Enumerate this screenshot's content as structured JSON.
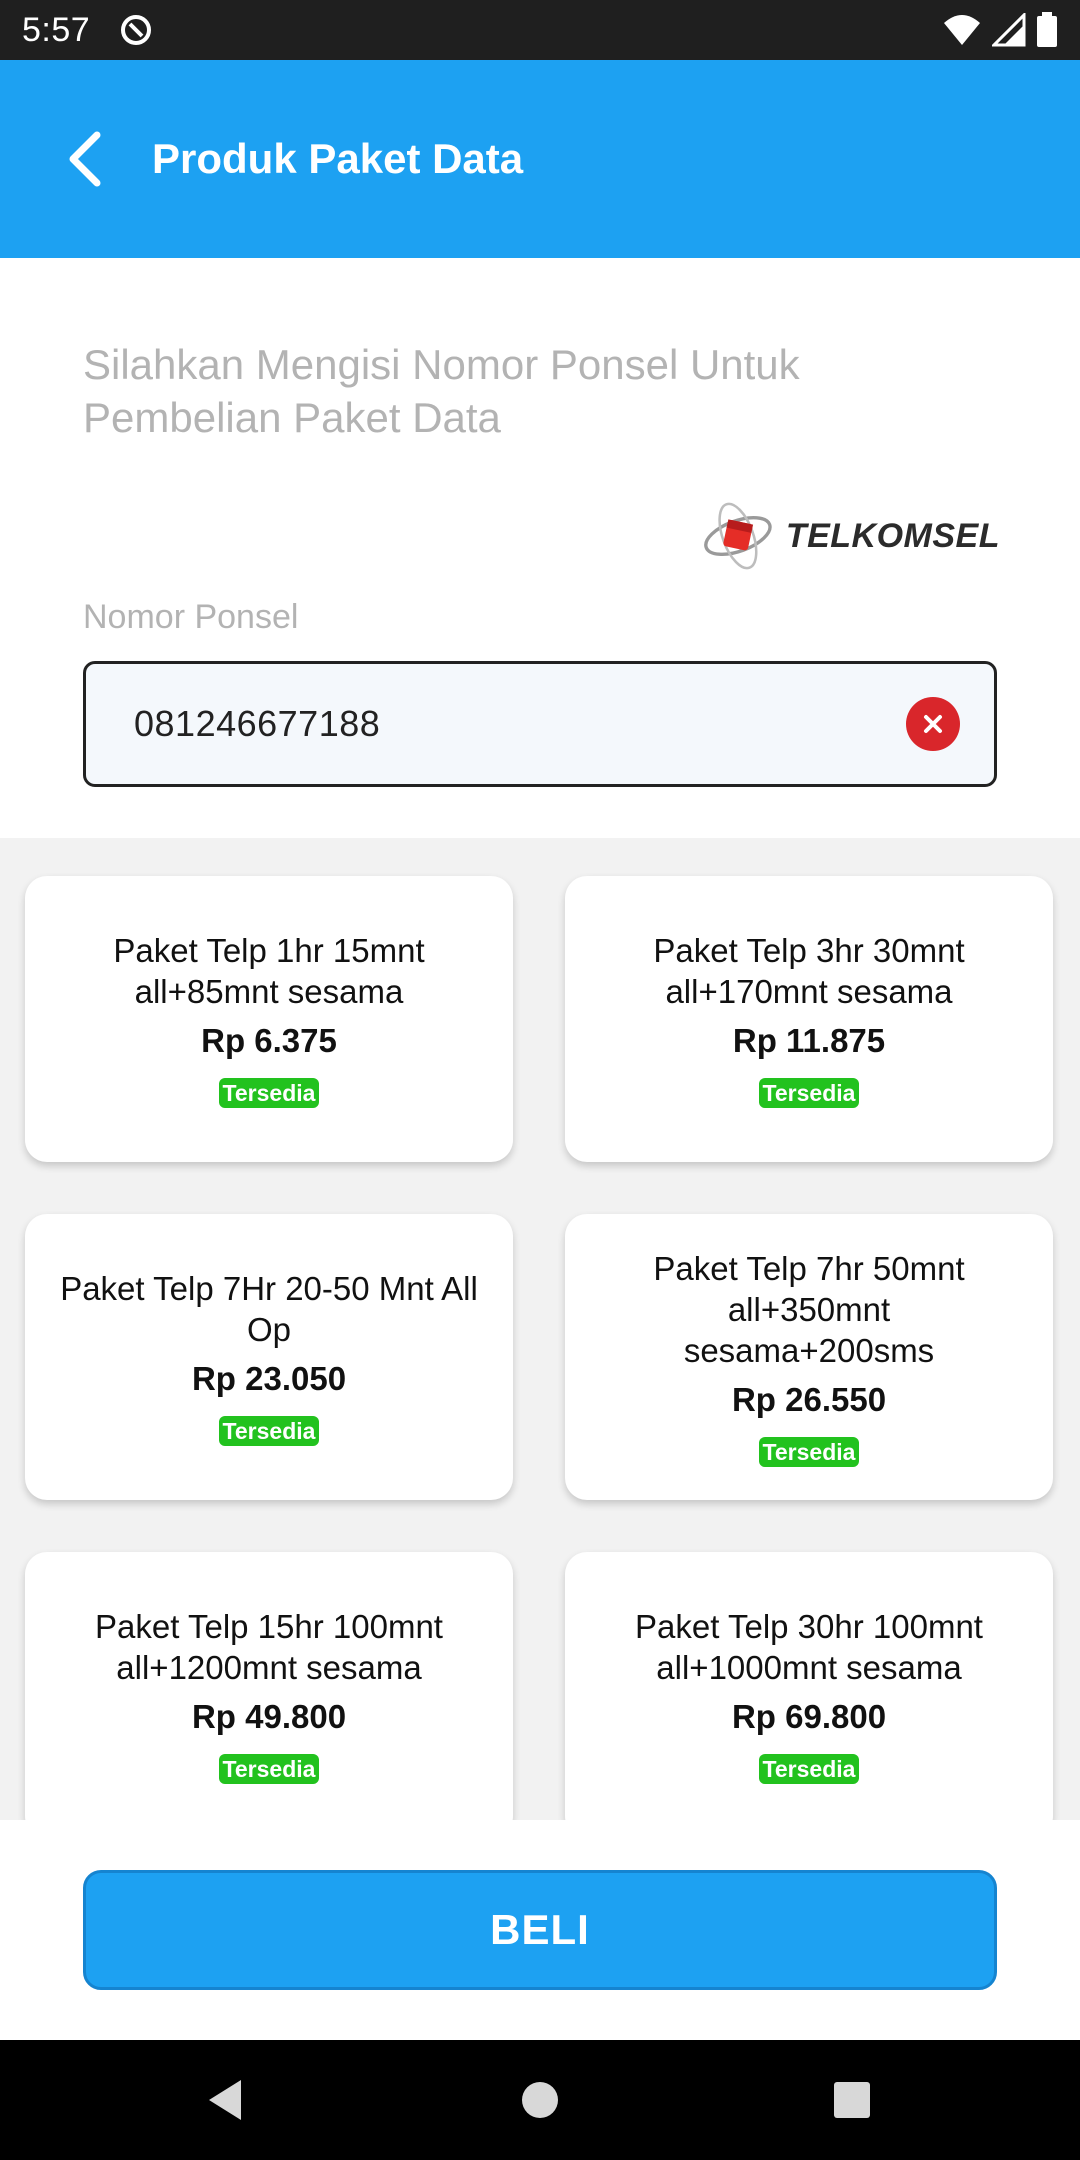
{
  "status_bar": {
    "time": "5:57"
  },
  "app_bar": {
    "title": "Produk Paket Data"
  },
  "form": {
    "instruction": "Silahkan Mengisi Nomor Ponsel Untuk Pembelian Paket Data",
    "operator": "TELKOMSEL",
    "phone_label": "Nomor Ponsel",
    "phone_value": "081246677188"
  },
  "packages": [
    {
      "name": "Paket Telp 1hr 15mnt all+85mnt sesama",
      "price": "Rp 6.375",
      "status": "Tersedia"
    },
    {
      "name": "Paket Telp 3hr 30mnt all+170mnt sesama",
      "price": "Rp 11.875",
      "status": "Tersedia"
    },
    {
      "name": "Paket Telp 7Hr 20-50 Mnt All Op",
      "price": "Rp 23.050",
      "status": "Tersedia"
    },
    {
      "name": "Paket Telp 7hr 50mnt all+350mnt sesama+200sms",
      "price": "Rp 26.550",
      "status": "Tersedia"
    },
    {
      "name": "Paket Telp 15hr 100mnt all+1200mnt sesama",
      "price": "Rp 49.800",
      "status": "Tersedia"
    },
    {
      "name": "Paket Telp 30hr 100mnt all+1000mnt sesama",
      "price": "Rp 69.800",
      "status": "Tersedia"
    }
  ],
  "buy_button": {
    "label": "BELI"
  },
  "colors": {
    "primary": "#1da1f2",
    "available": "#22c21e",
    "clear": "#d9262b"
  }
}
